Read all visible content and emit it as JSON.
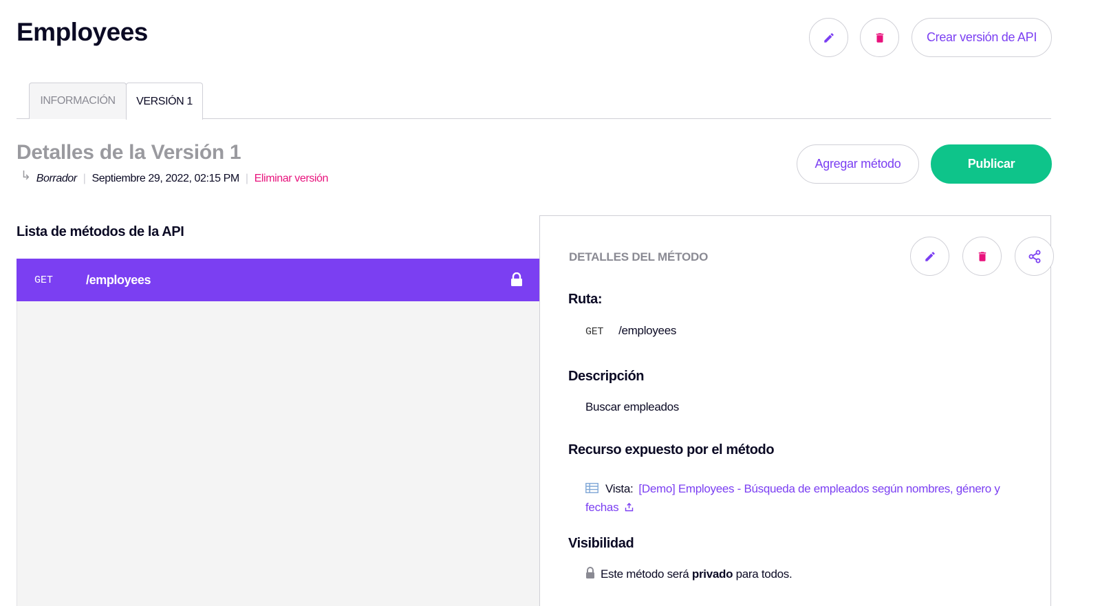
{
  "header": {
    "title": "Employees",
    "create_version_label": "Crear versión de API"
  },
  "tabs": [
    {
      "label": "INFORMACIÓN",
      "active": false
    },
    {
      "label": "VERSIÓN 1",
      "active": true
    }
  ],
  "version": {
    "title": "Detalles de la Versión 1",
    "status": "Borrador",
    "date": "Septiembre 29, 2022, 02:15 PM",
    "delete_label": "Eliminar versión",
    "add_method_label": "Agregar método",
    "publish_label": "Publicar"
  },
  "methods_list": {
    "heading": "Lista de métodos de la API",
    "items": [
      {
        "verb": "GET",
        "path": "/employees",
        "icon": "lock-icon"
      }
    ]
  },
  "method_details": {
    "heading": "DETALLES DEL MÉTODO",
    "route_title": "Ruta:",
    "route_verb": "GET",
    "route_path": "/employees",
    "description_title": "Descripción",
    "description": "Buscar empleados",
    "resource_title": "Recurso expuesto por el método",
    "resource_label": "Vista:",
    "resource_link": "[Demo] Employees - Búsqueda de empleados según nombres, género y fechas",
    "visibility_title": "Visibilidad",
    "visibility_prefix": "Este método será",
    "visibility_value": "privado",
    "visibility_suffix": "para todos."
  },
  "colors": {
    "accent": "#7b3ff2",
    "danger": "#e8127c",
    "success": "#0ec48a",
    "text": "#0b0a24",
    "muted": "#9a9a9f"
  }
}
